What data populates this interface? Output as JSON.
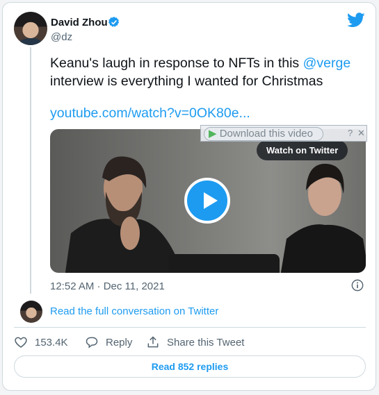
{
  "author": {
    "name": "David Zhou",
    "handle": "@dz"
  },
  "tweet": {
    "text_part1": "Keanu's laugh in response to NFTs in this ",
    "mention": "@verge",
    "text_part2": "interview is everything I wanted for Christmas",
    "link": "youtube.com/watch?v=0OK80e..."
  },
  "video": {
    "watch_label": "Watch on Twitter",
    "download_label": "Download this video",
    "help_glyph": "?",
    "close_glyph": "✕"
  },
  "timestamp": "12:52 AM · Dec 11, 2021",
  "conversation_link": "Read the full conversation on Twitter",
  "actions": {
    "like_count": "153.4K",
    "reply_label": "Reply",
    "share_label": "Share this Tweet"
  },
  "replies_button": "Read 852 replies",
  "colors": {
    "accent": "#1d9bf0",
    "secondary_text": "#536471",
    "border": "#cfd9de"
  },
  "icons": [
    "verified-badge-icon",
    "twitter-bird-icon",
    "play-icon",
    "info-icon",
    "heart-icon",
    "reply-bubble-icon",
    "share-icon"
  ]
}
